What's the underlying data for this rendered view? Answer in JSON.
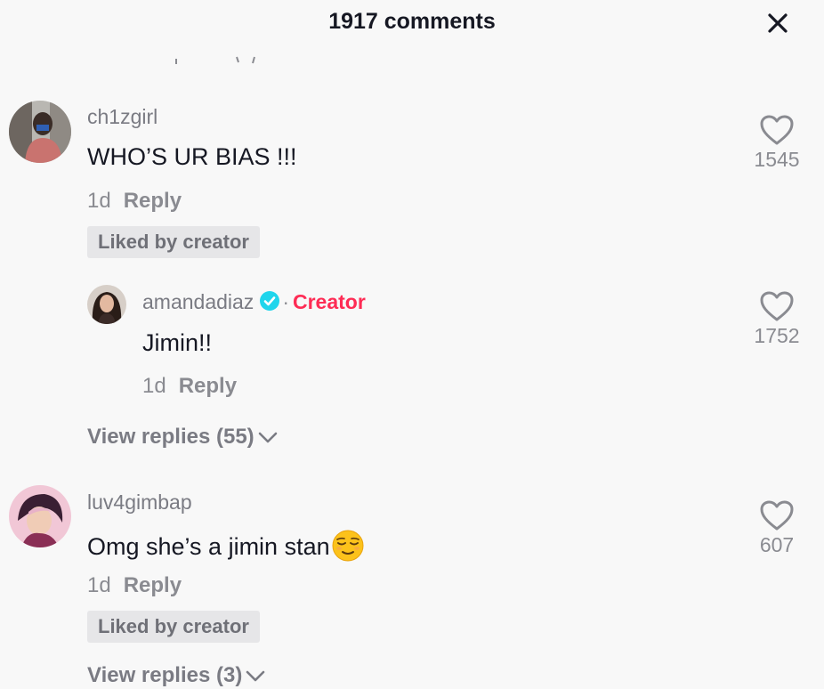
{
  "header": {
    "title": "1917 comments",
    "close_icon": "close-icon"
  },
  "comments": [
    {
      "username": "ch1zgirl",
      "text": "WHO’S UR BIAS !!!",
      "age": "1d",
      "reply_label": "Reply",
      "badge": "Liked by creator",
      "likes": "1545",
      "replies": [
        {
          "username": "amandadiaz",
          "separator": "·",
          "creator_label": "Creator",
          "text": "Jimin!!",
          "age": "1d",
          "reply_label": "Reply",
          "likes": "1752"
        }
      ],
      "view_replies": "View replies (55)"
    },
    {
      "username": "luv4gimbap",
      "text": "Omg she’s a jimin stan",
      "emoji": "relieved-face",
      "age": "1d",
      "reply_label": "Reply",
      "badge": "Liked by creator",
      "likes": "607",
      "view_replies": "View replies (3)"
    }
  ],
  "colors": {
    "creator_accent": "#fe2c55",
    "verified": "#20d5ec",
    "background": "#f8f8f8"
  }
}
